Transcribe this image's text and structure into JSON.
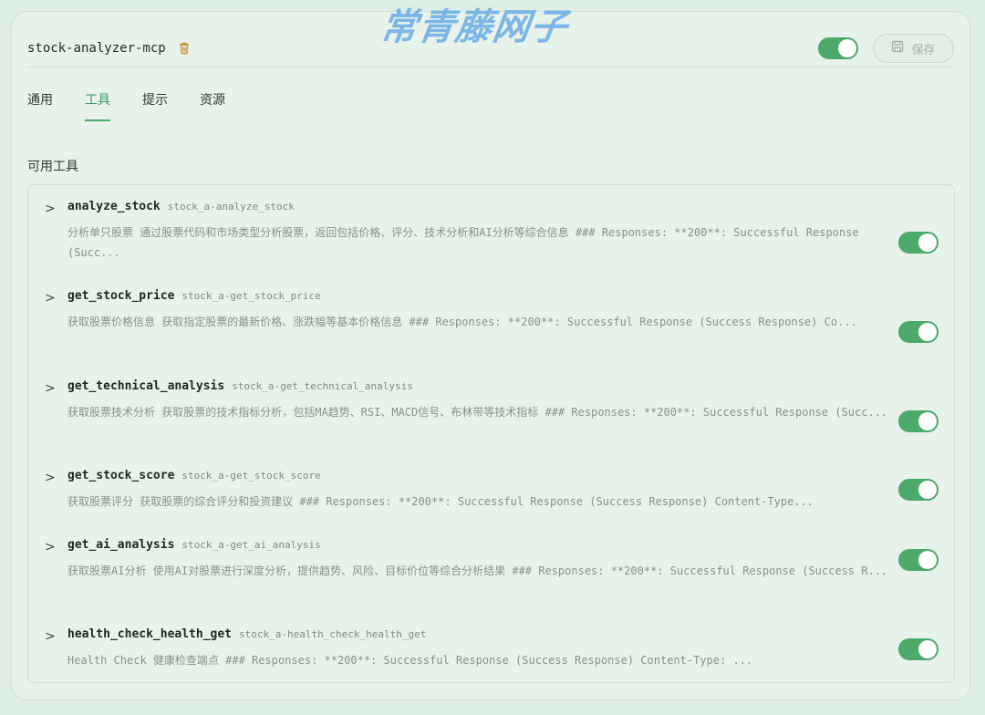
{
  "header": {
    "server_name": "stock-analyzer-mcp",
    "watermark": "常青藤网子",
    "save_label": "保存",
    "enabled": true
  },
  "tabs": [
    {
      "label": "通用",
      "active": false
    },
    {
      "label": "工具",
      "active": true
    },
    {
      "label": "提示",
      "active": false
    },
    {
      "label": "资源",
      "active": false
    }
  ],
  "section_title": "可用工具",
  "tools": [
    {
      "name": "analyze_stock",
      "id": "stock_a-analyze_stock",
      "description": "分析单只股票 通过股票代码和市场类型分析股票，返回包括价格、评分、技术分析和AI分析等综合信息 ### Responses: **200**: Successful Response (Succ...",
      "enabled": true
    },
    {
      "name": "get_stock_price",
      "id": "stock_a-get_stock_price",
      "description": "获取股票价格信息 获取指定股票的最新价格、涨跌幅等基本价格信息 ### Responses: **200**: Successful Response (Success Response) Co...",
      "enabled": true
    },
    {
      "name": "get_technical_analysis",
      "id": "stock_a-get_technical_analysis",
      "description": "获取股票技术分析 获取股票的技术指标分析，包括MA趋势、RSI、MACD信号、布林带等技术指标 ### Responses: **200**: Successful Response (Succ...",
      "enabled": true
    },
    {
      "name": "get_stock_score",
      "id": "stock_a-get_stock_score",
      "description": "获取股票评分 获取股票的综合评分和投资建议 ### Responses: **200**: Successful Response (Success Response) Content-Type...",
      "enabled": true
    },
    {
      "name": "get_ai_analysis",
      "id": "stock_a-get_ai_analysis",
      "description": "获取股票AI分析 使用AI对股票进行深度分析，提供趋势、风险、目标价位等综合分析结果 ### Responses: **200**: Successful Response (Success R...",
      "enabled": true
    },
    {
      "name": "health_check_health_get",
      "id": "stock_a-health_check_health_get",
      "description": "Health Check 健康检查端点 ### Responses: **200**: Successful Response (Success Response) Content-Type: ...",
      "enabled": true
    }
  ]
}
